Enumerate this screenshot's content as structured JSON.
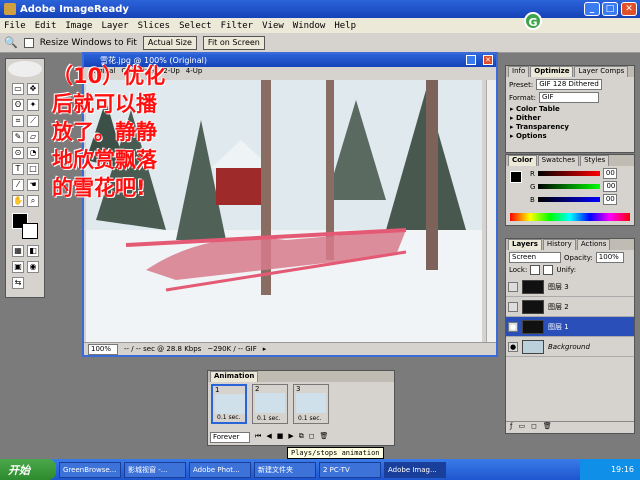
{
  "app": {
    "title": "Adobe ImageReady"
  },
  "menu": [
    "File",
    "Edit",
    "Image",
    "Layer",
    "Slices",
    "Select",
    "Filter",
    "View",
    "Window",
    "Help"
  ],
  "options_bar": {
    "resize_label": "Resize Windows to Fit",
    "actual_size": "Actual Size",
    "fit_on_screen": "Fit on Screen"
  },
  "document": {
    "title": "雪花.jpg @ 100% (Original)",
    "tabs": [
      "Original",
      "Optimized",
      "2-Up",
      "4-Up"
    ],
    "status": {
      "zoom": "100%",
      "speed": "-- / -- sec @ 28.8 Kbps",
      "size": "~290K / -- GIF",
      "arrow": "▸"
    }
  },
  "overlay_text": [
    "（10）优化",
    "后就可以播",
    "放了。静静",
    "地欣赏飘落",
    "的雪花吧!"
  ],
  "optimize_panel": {
    "tabs": [
      "Info",
      "Optimize",
      "Layer Comps"
    ],
    "preset_label": "Preset:",
    "preset_value": "GIF 128 Dithered",
    "format_label": "Format:",
    "format_value": "GIF",
    "sections": [
      "Color Table",
      "Dither",
      "Transparency",
      "Options"
    ]
  },
  "color_panel": {
    "tabs": [
      "Color",
      "Swatches",
      "Styles"
    ],
    "channels": [
      {
        "label": "R",
        "value": "00"
      },
      {
        "label": "G",
        "value": "00"
      },
      {
        "label": "B",
        "value": "00"
      }
    ]
  },
  "layers_panel": {
    "tabs": [
      "Layers",
      "History",
      "Actions"
    ],
    "blend_mode": "Screen",
    "opacity_label": "Opacity:",
    "opacity_value": "100%",
    "lock_label": "Lock:",
    "unify_label": "Unify:",
    "layers": [
      {
        "name": "图层 3",
        "selected": false
      },
      {
        "name": "图层 2",
        "selected": false
      },
      {
        "name": "图层 1",
        "selected": true
      },
      {
        "name": "Background",
        "selected": false
      }
    ]
  },
  "animation": {
    "title": "Animation",
    "frames": [
      {
        "num": "1",
        "delay": "0.1 sec."
      },
      {
        "num": "2",
        "delay": "0.1 sec."
      },
      {
        "num": "3",
        "delay": "0.1 sec."
      }
    ],
    "loop": "Forever"
  },
  "tooltip": "Plays/stops animation",
  "taskbar": {
    "start": "开始",
    "tasks": [
      "GreenBrowse...",
      "影城视窗 -...",
      "Adobe Phot...",
      "新建文件夹",
      "2 PC-TV",
      "Adobe Imag..."
    ],
    "clock": "19:16"
  },
  "colors": {
    "accent": "#2b63d9",
    "overlay_text": "#ff1010",
    "selected_layer": "#2b4fb8"
  }
}
